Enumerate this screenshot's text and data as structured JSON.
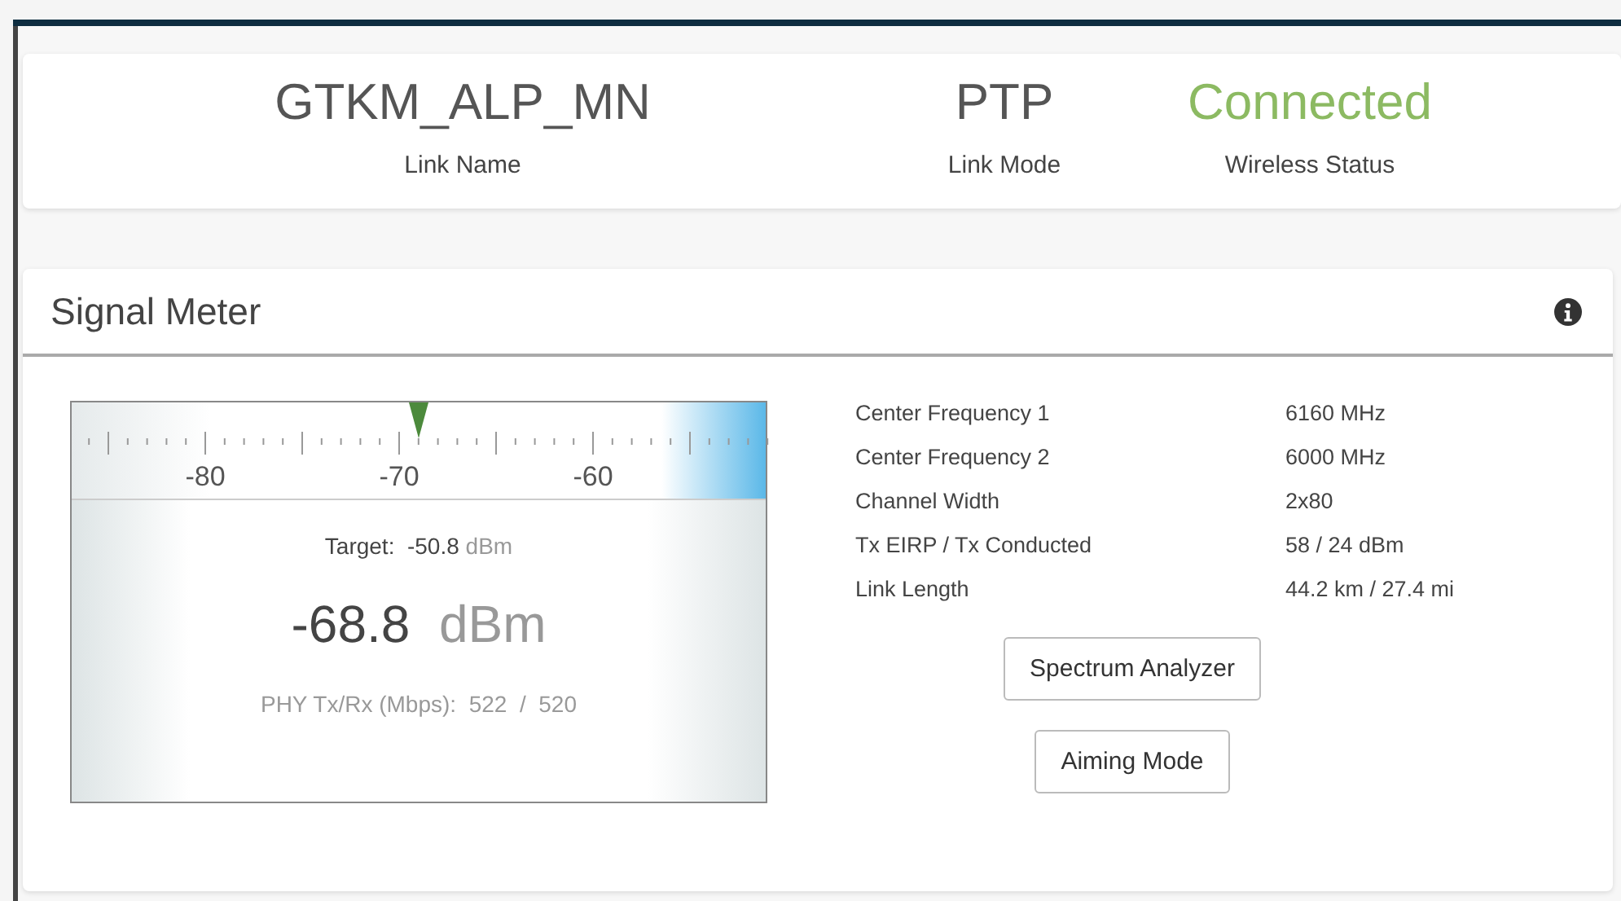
{
  "summary": [
    {
      "value": "GTKM_ALP_MN",
      "label": "Link Name",
      "kind": "plain"
    },
    {
      "value": "PTP",
      "label": "Link Mode",
      "kind": "plain"
    },
    {
      "value": "Connected",
      "label": "Wireless Status",
      "kind": "status"
    }
  ],
  "signal_meter": {
    "title": "Signal Meter",
    "meter": {
      "scale_labels": [
        "-80",
        "-70",
        "-60"
      ],
      "target_label": "Target:",
      "target_value": "-50.8",
      "target_unit": "dBm",
      "reading": "-68.8",
      "reading_unit": "dBm",
      "phy_label": "PHY Tx/Rx (Mbps):",
      "phy_tx": "522",
      "phy_sep": "/",
      "phy_rx": "520"
    },
    "details": [
      {
        "label": "Center Frequency 1",
        "value": "6160 MHz"
      },
      {
        "label": "Center Frequency 2",
        "value": "6000 MHz"
      },
      {
        "label": "Channel Width",
        "value": "2x80"
      },
      {
        "label": "Tx EIRP / Tx Conducted",
        "value": "58 / 24 dBm"
      },
      {
        "label": "Link Length",
        "value": "44.2 km / 27.4 mi"
      }
    ],
    "buttons": [
      "Spectrum Analyzer",
      "Aiming Mode"
    ]
  }
}
